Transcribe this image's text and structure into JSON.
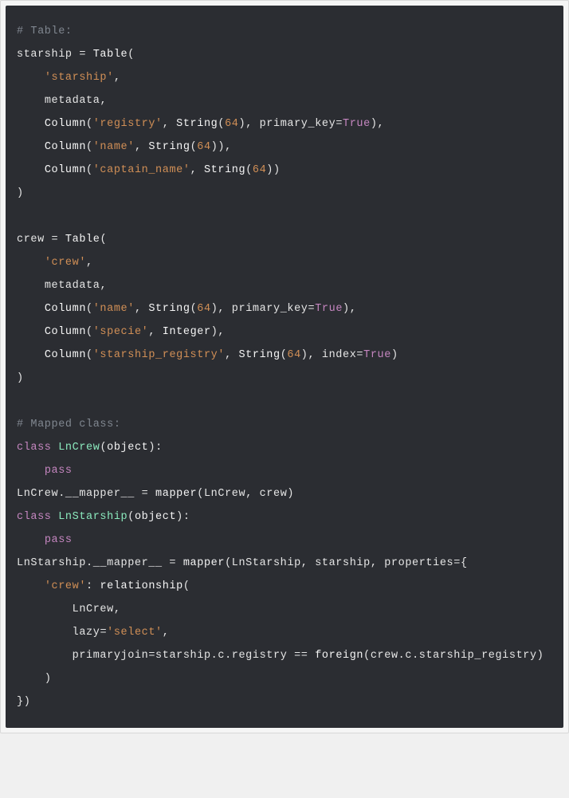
{
  "colors": {
    "background": "#2b2d32",
    "default_text": "#e6e6e6",
    "comment": "#808790",
    "string": "#d18f56",
    "number": "#d18f56",
    "constant": "#c586c0",
    "keyword": "#c586c0",
    "classname": "#8be9bd"
  },
  "language": "python",
  "t": {
    "c_table": "# Table:",
    "starship": "starship",
    "eq": " = ",
    "Table": "Table",
    "lp": "(",
    "rp": ")",
    "comma": ",",
    "colon": ":",
    "dot": ".",
    "lb": "{",
    "rb": "}",
    "star_tbl": "'starship'",
    "metadata": "metadata",
    "Column": "Column",
    "registry": "'registry'",
    "String": "String",
    "n64": "64",
    "pk": "primary_key",
    "True": "True",
    "name": "'name'",
    "captain": "'captain_name'",
    "crew": "crew",
    "crew_tbl": "'crew'",
    "specie": "'specie'",
    "Integer": "Integer",
    "st_reg": "'starship_registry'",
    "index": "index",
    "c_mapped": "# Mapped class:",
    "class": "class",
    "LnCrew": "LnCrew",
    "object": "object",
    "pass": "pass",
    "mapper_attr": "__mapper__",
    "mapper": "mapper",
    "LnStarship": "LnStarship",
    "properties": "properties",
    "crew_key": "'crew'",
    "relationship": "relationship",
    "lazy": "lazy",
    "select": "'select'",
    "primaryjoin": "primaryjoin",
    "c": "c",
    "registry_attr": "registry",
    "eqeq": " == ",
    "foreign": "foreign",
    "st_reg_attr": "starship_registry"
  }
}
